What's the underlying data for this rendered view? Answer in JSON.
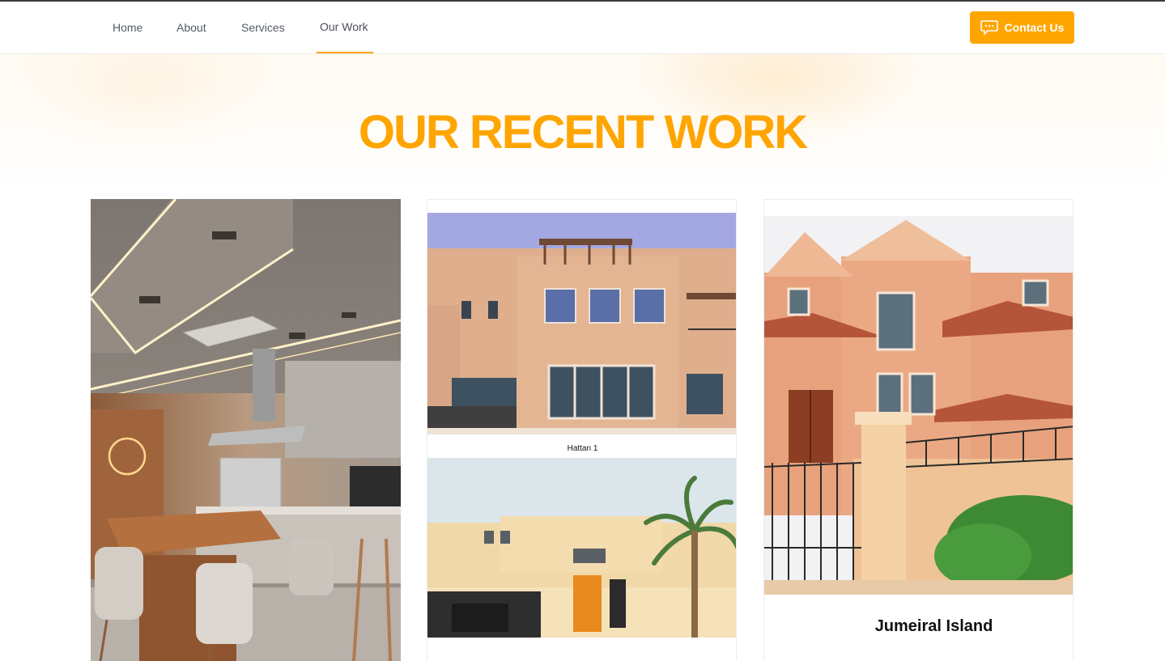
{
  "nav": {
    "items": [
      {
        "label": "Home"
      },
      {
        "label": "About"
      },
      {
        "label": "Services"
      },
      {
        "label": "Our Work"
      }
    ],
    "active": "Our Work",
    "contact_label": "Contact Us",
    "contact_icon": "chat-bubble-icon"
  },
  "section": {
    "title": "OUR RECENT WORK"
  },
  "projects": [
    {
      "caption": ""
    },
    {
      "caption": "Hattan 1"
    },
    {
      "caption": "Jumeiral Island"
    }
  ],
  "colors": {
    "accent": "#ffa500",
    "nav_text": "#555b66"
  }
}
